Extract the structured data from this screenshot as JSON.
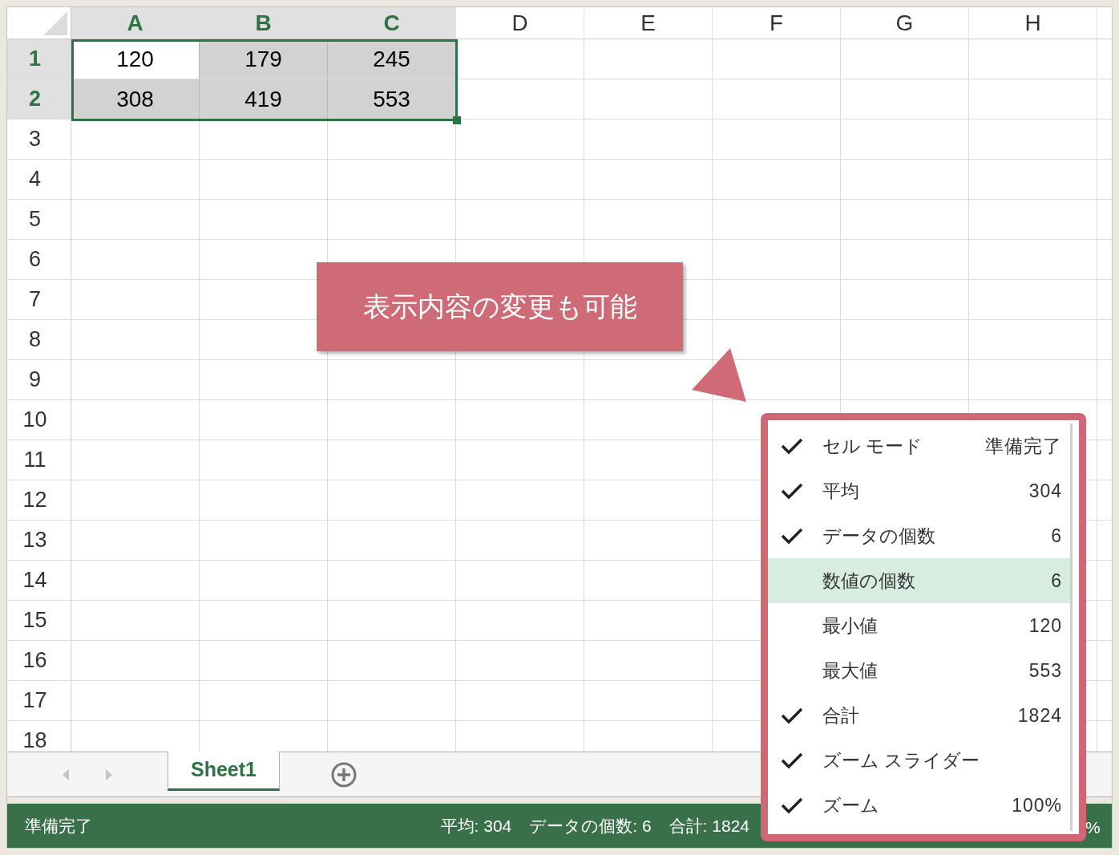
{
  "columns": [
    {
      "label": "A",
      "selected": true
    },
    {
      "label": "B",
      "selected": true
    },
    {
      "label": "C",
      "selected": true
    },
    {
      "label": "D",
      "selected": false
    },
    {
      "label": "E",
      "selected": false
    },
    {
      "label": "F",
      "selected": false
    },
    {
      "label": "G",
      "selected": false
    },
    {
      "label": "H",
      "selected": false
    }
  ],
  "rows": [
    {
      "label": "1",
      "selected": true,
      "cells": [
        {
          "value": "120",
          "active": true
        },
        {
          "value": "179",
          "selected": true,
          "active": false
        },
        {
          "value": "245",
          "selected": true,
          "active": false
        }
      ]
    },
    {
      "label": "2",
      "selected": true,
      "cells": [
        {
          "value": "308",
          "selected": true,
          "active": false
        },
        {
          "value": "419",
          "selected": true,
          "active": false
        },
        {
          "value": "553",
          "selected": true,
          "active": false
        }
      ]
    },
    {
      "label": "3",
      "selected": false
    },
    {
      "label": "4",
      "selected": false
    },
    {
      "label": "5",
      "selected": false
    },
    {
      "label": "6",
      "selected": false
    },
    {
      "label": "7",
      "selected": false
    },
    {
      "label": "8",
      "selected": false
    },
    {
      "label": "9",
      "selected": false
    },
    {
      "label": "10",
      "selected": false
    },
    {
      "label": "11",
      "selected": false
    },
    {
      "label": "12",
      "selected": false
    },
    {
      "label": "13",
      "selected": false
    },
    {
      "label": "14",
      "selected": false
    },
    {
      "label": "15",
      "selected": false
    },
    {
      "label": "16",
      "selected": false
    },
    {
      "label": "17",
      "selected": false
    },
    {
      "label": "18",
      "selected": false
    }
  ],
  "callout": {
    "text": "表示内容の変更も可能"
  },
  "sheet_tabs": [
    {
      "label": "Sheet1",
      "selected": true
    }
  ],
  "status_bar": {
    "mode": "準備完了",
    "summaries": [
      "平均: 304",
      "データの個数: 6",
      "合計: 1824"
    ],
    "zoom_fragment": "%"
  },
  "menu": {
    "items": [
      {
        "label": "セル モード",
        "value": "準備完了",
        "checked": true,
        "selected": false
      },
      {
        "label": "平均",
        "value": "304",
        "checked": true,
        "selected": false
      },
      {
        "label": "データの個数",
        "value": "6",
        "checked": true,
        "selected": false
      },
      {
        "label": "数値の個数",
        "value": "6",
        "checked": false,
        "selected": true
      },
      {
        "label": "最小値",
        "value": "120",
        "checked": false,
        "selected": false
      },
      {
        "label": "最大値",
        "value": "553",
        "checked": false,
        "selected": false
      },
      {
        "label": "合計",
        "value": "1824",
        "checked": true,
        "selected": false
      },
      {
        "label": "ズーム スライダー",
        "checked": true,
        "selected": false
      },
      {
        "label": "ズーム",
        "value": "100%",
        "checked": true,
        "selected": false
      }
    ]
  }
}
